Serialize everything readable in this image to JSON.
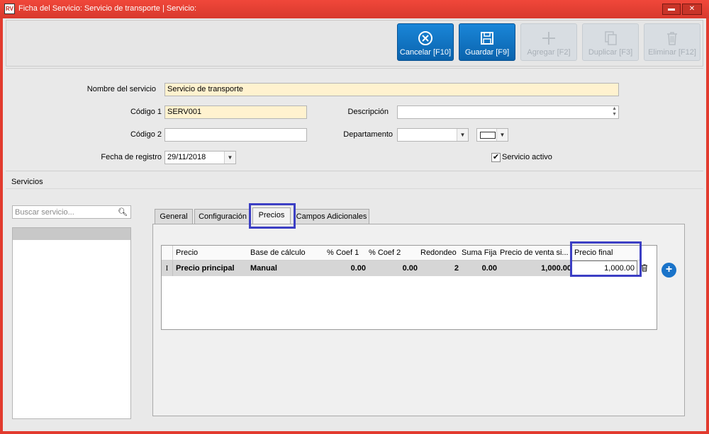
{
  "window": {
    "title": "Ficha del Servicio: Servicio de transporte | Servicio:",
    "app_icon": "RV",
    "minimize_glyph": "▬",
    "close_glyph": "✕"
  },
  "toolbar": {
    "buttons": [
      {
        "label": "Cancelar [F10]",
        "icon": "cancel-circle-icon",
        "enabled": true
      },
      {
        "label": "Guardar [F9]",
        "icon": "floppy-disk-icon",
        "enabled": true
      },
      {
        "label": "Agregar [F2]",
        "icon": "plus-icon",
        "enabled": false
      },
      {
        "label": "Duplicar [F3]",
        "icon": "copy-icon",
        "enabled": false
      },
      {
        "label": "Eliminar [F12]",
        "icon": "trash-icon",
        "enabled": false
      }
    ]
  },
  "form": {
    "nombre_label": "Nombre del servicio",
    "nombre_value": "Servicio de transporte",
    "codigo1_label": "Código 1",
    "codigo1_value": "SERV001",
    "descripcion_label": "Descripción",
    "descripcion_value": "",
    "codigo2_label": "Código 2",
    "codigo2_value": "",
    "departamento_label": "Departamento",
    "departamento_value": "",
    "fecha_label": "Fecha de registro",
    "fecha_value": "29/11/2018",
    "activo_label": "Servicio activo",
    "activo_checked": true
  },
  "section": {
    "title": "Servicios",
    "search_placeholder": "Buscar servicio..."
  },
  "tabs": [
    {
      "label": "General",
      "selected": false
    },
    {
      "label": "Configuración",
      "selected": false
    },
    {
      "label": "Precios",
      "selected": true
    },
    {
      "label": "Campos Adicionales",
      "selected": false
    }
  ],
  "grid": {
    "columns": [
      "Precio",
      "Base de cálculo",
      "% Coef 1",
      "% Coef 2",
      "Redondeo",
      "Suma Fija",
      "Precio de venta si...",
      "Precio final"
    ],
    "rows": [
      {
        "indicator": "I",
        "precio": "Precio principal",
        "base": "Manual",
        "coef1": "0.00",
        "coef2": "0.00",
        "redondeo": "2",
        "suma_fija": "0.00",
        "precio_venta": "1,000.00",
        "precio_final": "1,000.00"
      }
    ]
  },
  "colors": {
    "title_bar": "#e23b2e",
    "primary_button": "#0a6fc2",
    "highlight_box": "#3c3fc4",
    "required_field": "#fff2cf"
  }
}
